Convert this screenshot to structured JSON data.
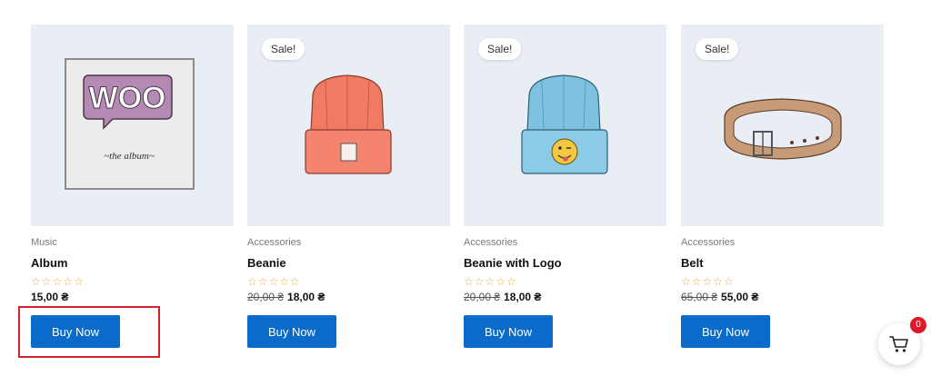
{
  "products": [
    {
      "category": "Music",
      "title": "Album",
      "sale": "",
      "old_price": "",
      "price": "15,00 ₴",
      "rating": "☆☆☆☆☆",
      "button": "Buy Now",
      "image": "woo-album-cover"
    },
    {
      "category": "Accessories",
      "title": "Beanie",
      "sale": "Sale!",
      "old_price": "20,00 ₴",
      "price": "18,00 ₴",
      "rating": "☆☆☆☆☆",
      "button": "Buy Now",
      "image": "orange-beanie"
    },
    {
      "category": "Accessories",
      "title": "Beanie with Logo",
      "sale": "Sale!",
      "old_price": "20,00 ₴",
      "price": "18,00 ₴",
      "rating": "☆☆☆☆☆",
      "button": "Buy Now",
      "image": "blue-beanie-with-emoji-logo"
    },
    {
      "category": "Accessories",
      "title": "Belt",
      "sale": "Sale!",
      "old_price": "65,00 ₴",
      "price": "55,00 ₴",
      "rating": "☆☆☆☆☆",
      "button": "Buy Now",
      "image": "leather-belt"
    }
  ],
  "album_art": {
    "logo_text": "WOO",
    "subtitle": "~the   album~"
  },
  "cart": {
    "count": "0",
    "icon": "cart-icon"
  },
  "colors": {
    "accent": "#0b6bcb",
    "highlight": "#d2232a",
    "badge": "#e0192a",
    "stars": "#e0a94b",
    "image_bg": "#e9eef4"
  }
}
